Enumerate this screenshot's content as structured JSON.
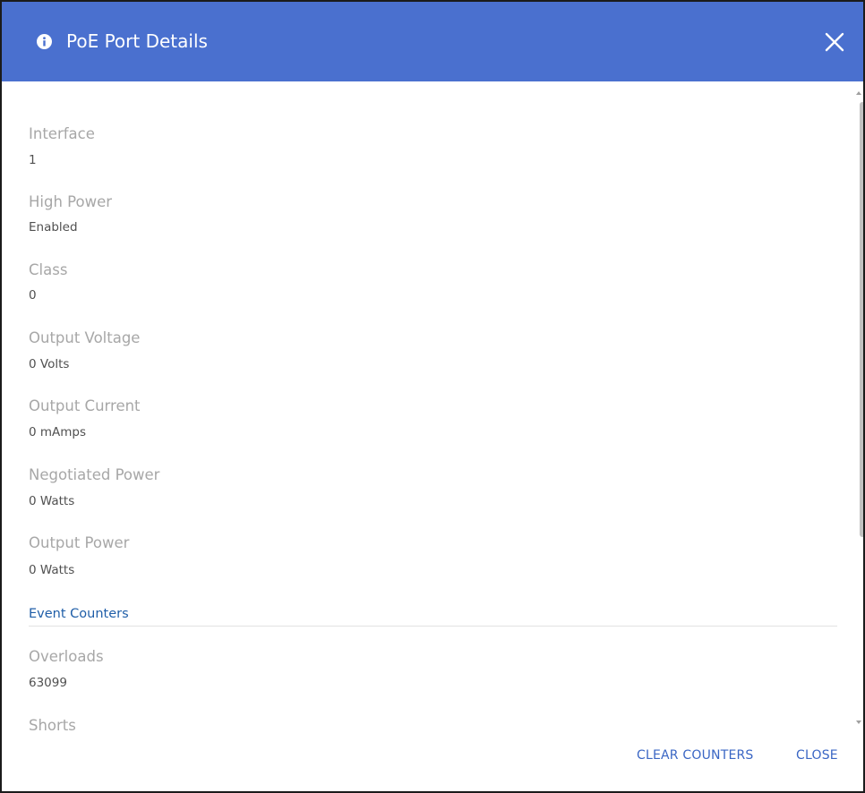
{
  "dialog": {
    "title": "PoE Port Details",
    "header_color": "#4a70cf",
    "title_icon": "info-icon",
    "close_icon": "close-icon"
  },
  "fields": [
    {
      "label": "Interface",
      "value": "1"
    },
    {
      "label": "High Power",
      "value": "Enabled"
    },
    {
      "label": "Class",
      "value": "0"
    },
    {
      "label": "Output Voltage",
      "value": "0 Volts"
    },
    {
      "label": "Output Current",
      "value": "0 mAmps"
    },
    {
      "label": "Negotiated Power",
      "value": "0 Watts"
    },
    {
      "label": "Output Power",
      "value": "0 Watts"
    }
  ],
  "event_counters": {
    "title": "Event Counters",
    "fields": [
      {
        "label": "Overloads",
        "value": "63099"
      },
      {
        "label": "Shorts",
        "value": ""
      }
    ]
  },
  "footer": {
    "clear_counters_label": "CLEAR COUNTERS",
    "close_label": "CLOSE"
  }
}
